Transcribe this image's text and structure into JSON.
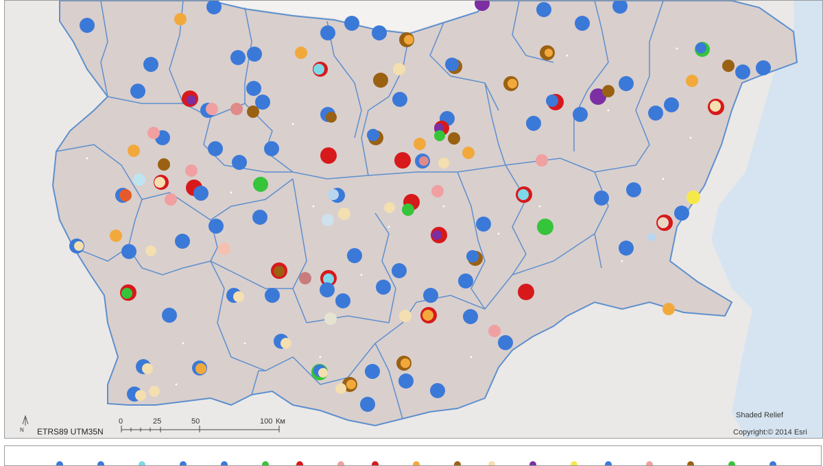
{
  "map": {
    "crs_label": "ETRS89 UTM35N",
    "north_label": "N",
    "scale_ticks": [
      "0",
      "25",
      "50",
      "100"
    ],
    "scale_unit": "Км",
    "basemap_title": "Shaded Relief",
    "copyright": "Copyright:© 2014 Esri",
    "colors": {
      "country_fill": "#d9cfcd",
      "region_border": "#5d8fce",
      "sea": "#d6e4f1",
      "background": "#ebe9e7"
    },
    "markers": [
      {
        "name": "blue",
        "color": "#3b79d8"
      },
      {
        "name": "orange",
        "color": "#f2a93b"
      },
      {
        "name": "red",
        "color": "#d7191c"
      },
      {
        "name": "purple",
        "color": "#7b2fa2"
      },
      {
        "name": "green",
        "color": "#36c43a"
      },
      {
        "name": "brown",
        "color": "#9a6113"
      },
      {
        "name": "pink",
        "color": "#f0a0a0"
      },
      {
        "name": "cyan",
        "color": "#7fd8e8"
      },
      {
        "name": "cream",
        "color": "#f4dfb0"
      },
      {
        "name": "yellow",
        "color": "#f5e94a"
      }
    ]
  }
}
